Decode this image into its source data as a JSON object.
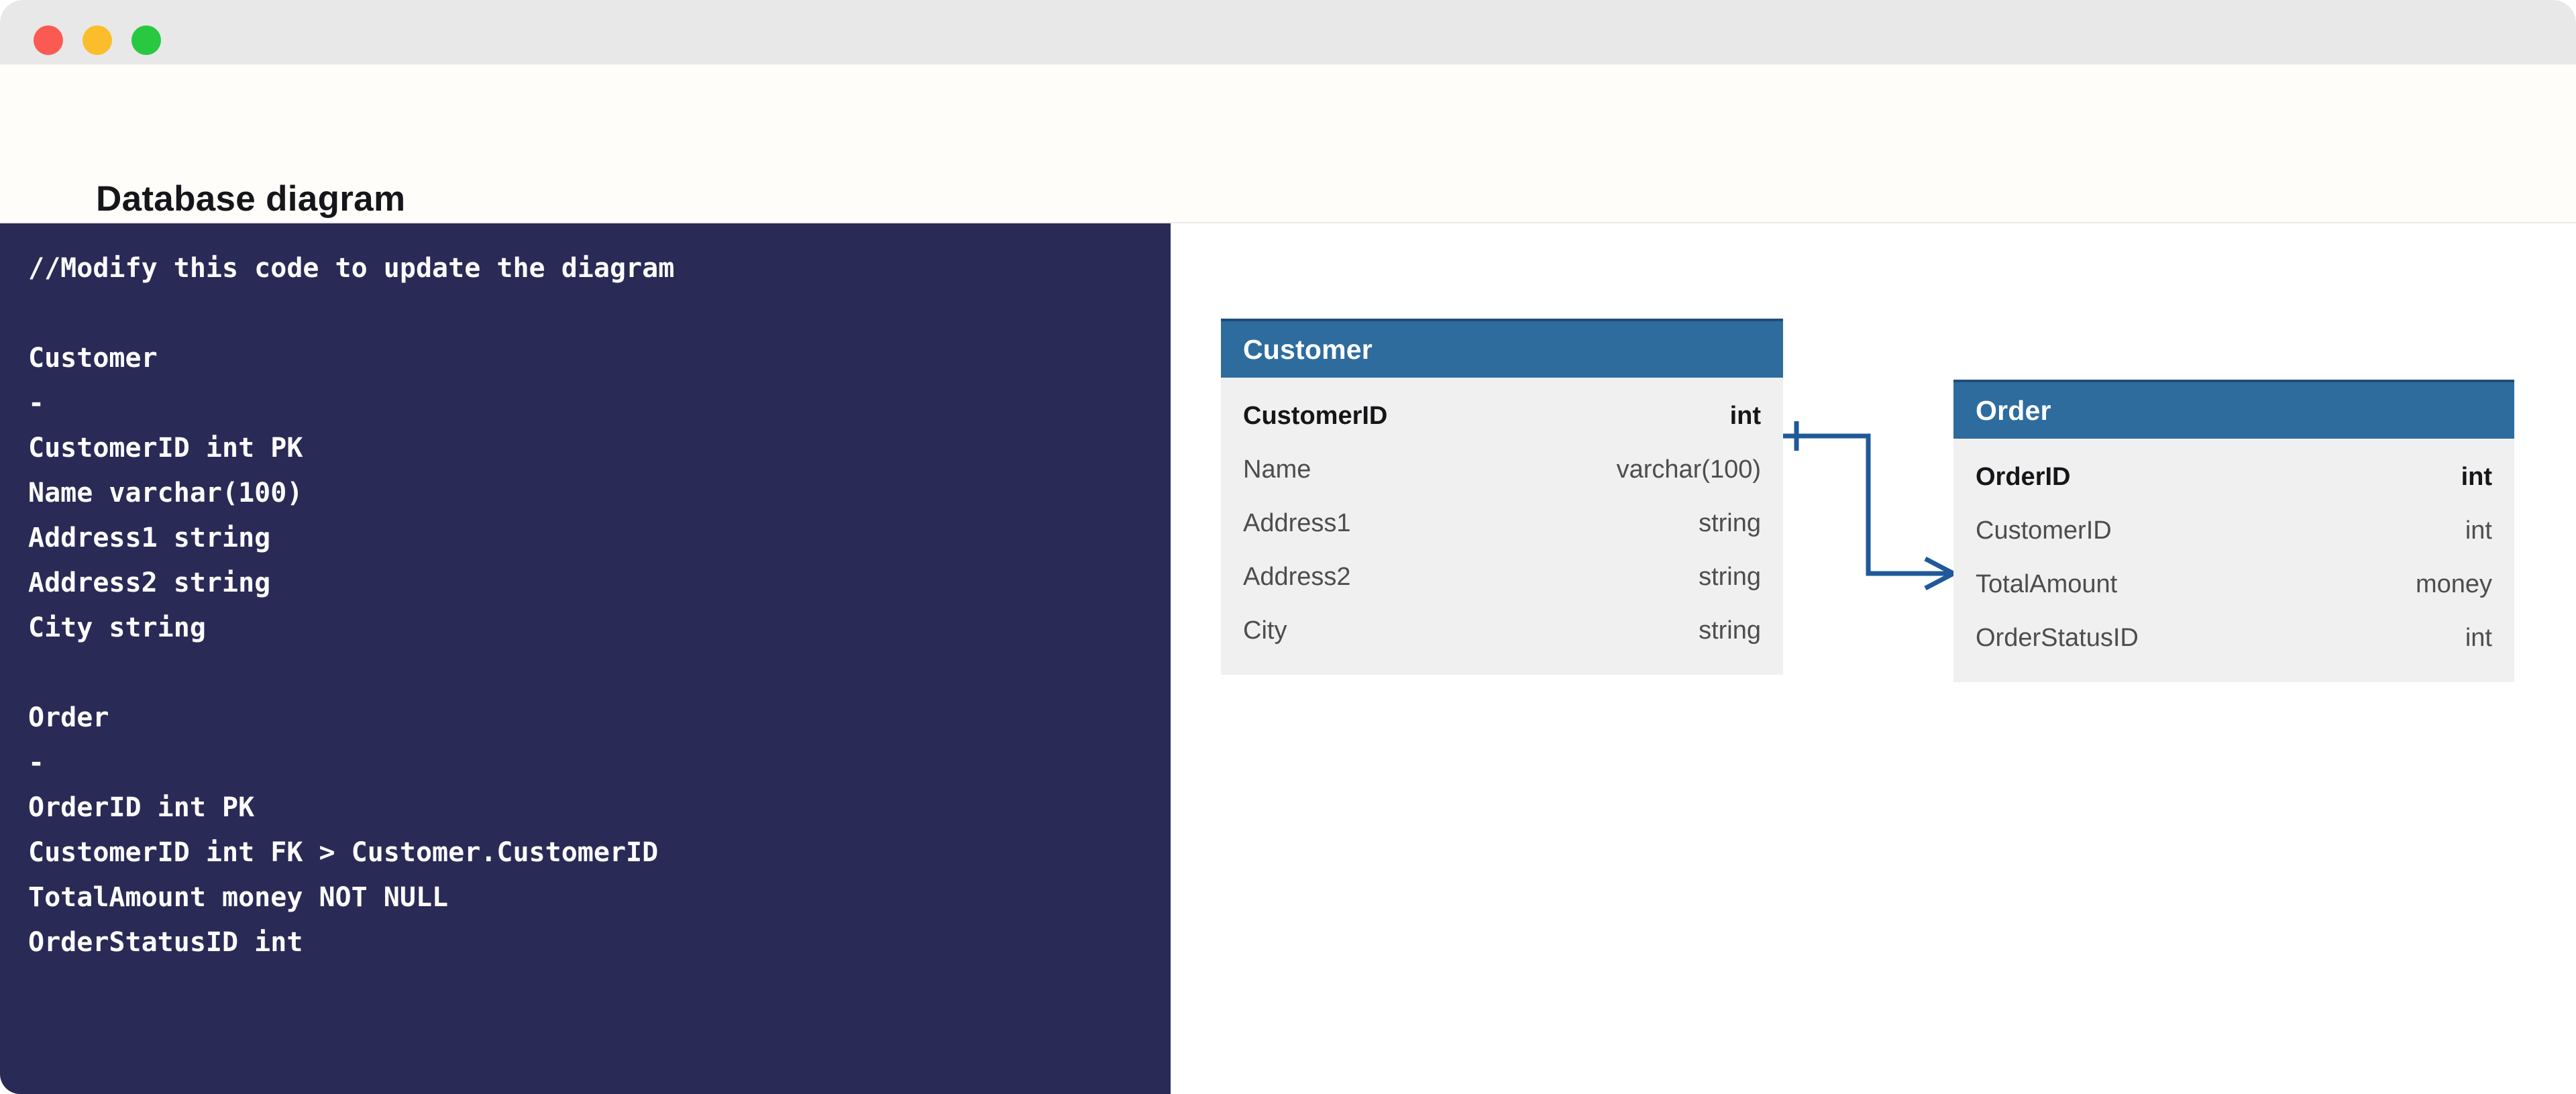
{
  "window": {
    "traffic_lights": [
      {
        "name": "close",
        "color": "#fb5a52"
      },
      {
        "name": "minimize",
        "color": "#fbbd2b"
      },
      {
        "name": "maximize",
        "color": "#28c840"
      }
    ]
  },
  "header": {
    "title": "Database diagram"
  },
  "editor": {
    "code": "//Modify this code to update the diagram\n\nCustomer\n-\nCustomerID int PK\nName varchar(100)\nAddress1 string\nAddress2 string\nCity string\n\nOrder\n-\nOrderID int PK\nCustomerID int FK > Customer.CustomerID\nTotalAmount money NOT NULL\nOrderStatusID int",
    "background_color": "#2a2a57",
    "text_color": "#fdfdfd"
  },
  "diagram": {
    "header_color": "#2e6c9e",
    "body_color": "#f0f0f0",
    "connector_color": "#1f5999",
    "entities": [
      {
        "name": "Customer",
        "columns": [
          {
            "name": "CustomerID",
            "type": "int",
            "key": true
          },
          {
            "name": "Name",
            "type": "varchar(100)",
            "key": false
          },
          {
            "name": "Address1",
            "type": "string",
            "key": false
          },
          {
            "name": "Address2",
            "type": "string",
            "key": false
          },
          {
            "name": "City",
            "type": "string",
            "key": false
          }
        ]
      },
      {
        "name": "Order",
        "columns": [
          {
            "name": "OrderID",
            "type": "int",
            "key": true
          },
          {
            "name": "CustomerID",
            "type": "int",
            "key": false
          },
          {
            "name": "TotalAmount",
            "type": "money",
            "key": false
          },
          {
            "name": "OrderStatusID",
            "type": "int",
            "key": false
          }
        ]
      }
    ],
    "relationship": {
      "from_entity": "Customer",
      "from_column": "CustomerID",
      "to_entity": "Order",
      "to_column": "CustomerID",
      "from_cardinality": "one",
      "to_cardinality": "many"
    }
  }
}
